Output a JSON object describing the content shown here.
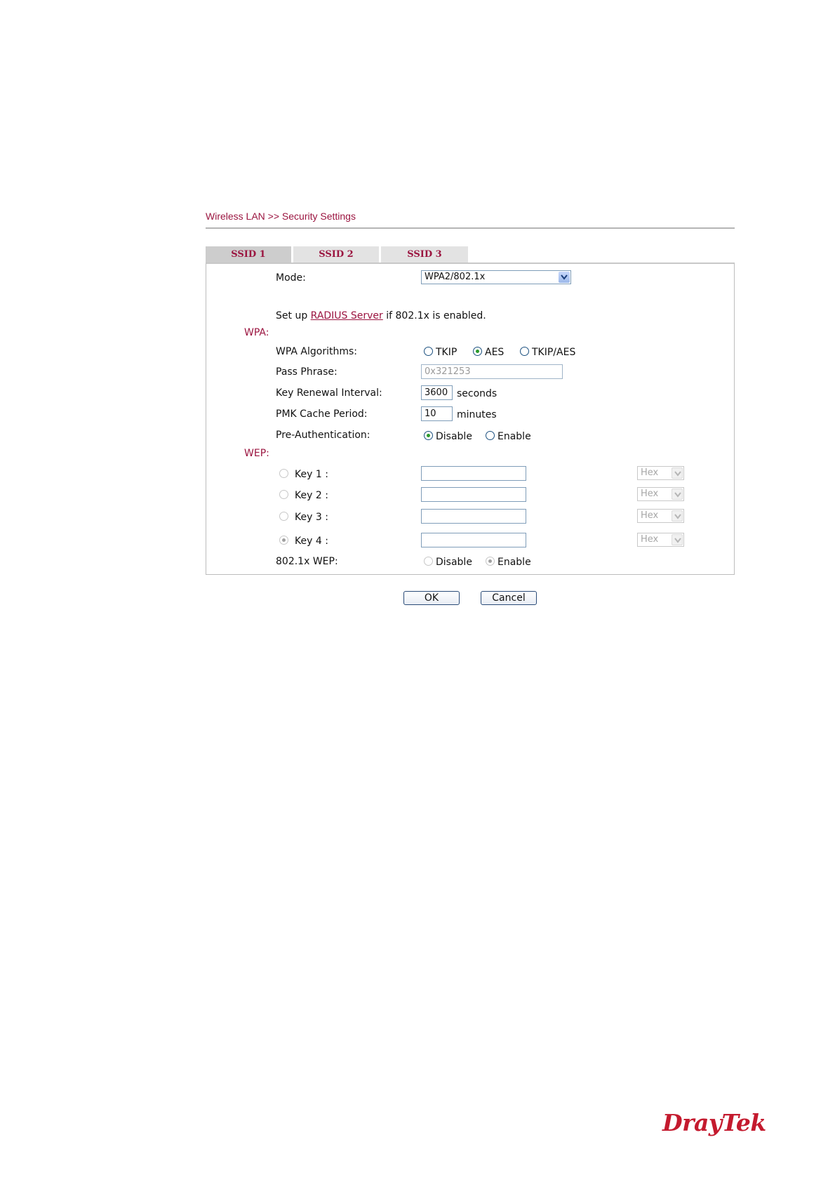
{
  "breadcrumb": "Wireless LAN >> Security Settings",
  "tabs": [
    "SSID 1",
    "SSID 2",
    "SSID 3"
  ],
  "mode": {
    "label": "Mode:",
    "value": "WPA2/802.1x"
  },
  "radius": {
    "prefix": "Set up",
    "link": "RADIUS Server",
    "suffix": "if 802.1x is enabled."
  },
  "wpa": {
    "heading": "WPA:",
    "algorithms_label": "WPA Algorithms:",
    "algorithms": [
      "TKIP",
      "AES",
      "TKIP/AES"
    ],
    "algorithm_selected": "AES",
    "pass_phrase_label": "Pass Phrase:",
    "pass_phrase_placeholder": "0x321253",
    "key_renewal_label": "Key Renewal Interval:",
    "key_renewal_value": "3600",
    "key_renewal_unit": "seconds",
    "pmk_label": "PMK Cache Period:",
    "pmk_value": "10",
    "pmk_unit": "minutes",
    "preauth_label": "Pre-Authentication:",
    "preauth_options": [
      "Disable",
      "Enable"
    ],
    "preauth_selected": "Disable"
  },
  "wep": {
    "heading": "WEP:",
    "keys": [
      {
        "label": "Key 1 :",
        "value": "",
        "format": "Hex"
      },
      {
        "label": "Key 2 :",
        "value": "",
        "format": "Hex"
      },
      {
        "label": "Key 3 :",
        "value": "",
        "format": "Hex"
      },
      {
        "label": "Key 4 :",
        "value": "",
        "format": "Hex"
      }
    ],
    "key_selected": "Key 4 :",
    "dot1x_label": "802.1x WEP:",
    "dot1x_options": [
      "Disable",
      "Enable"
    ],
    "dot1x_selected": "Enable"
  },
  "buttons": {
    "ok": "OK",
    "cancel": "Cancel"
  },
  "brand": "DrayTek",
  "colors": {
    "accent": "#9b1540",
    "logo": "#c41a2e",
    "radio_selected": "#2b9a2b"
  },
  "icons": {
    "dropdown": "chevron-down-icon",
    "radio": "radio-icon"
  }
}
